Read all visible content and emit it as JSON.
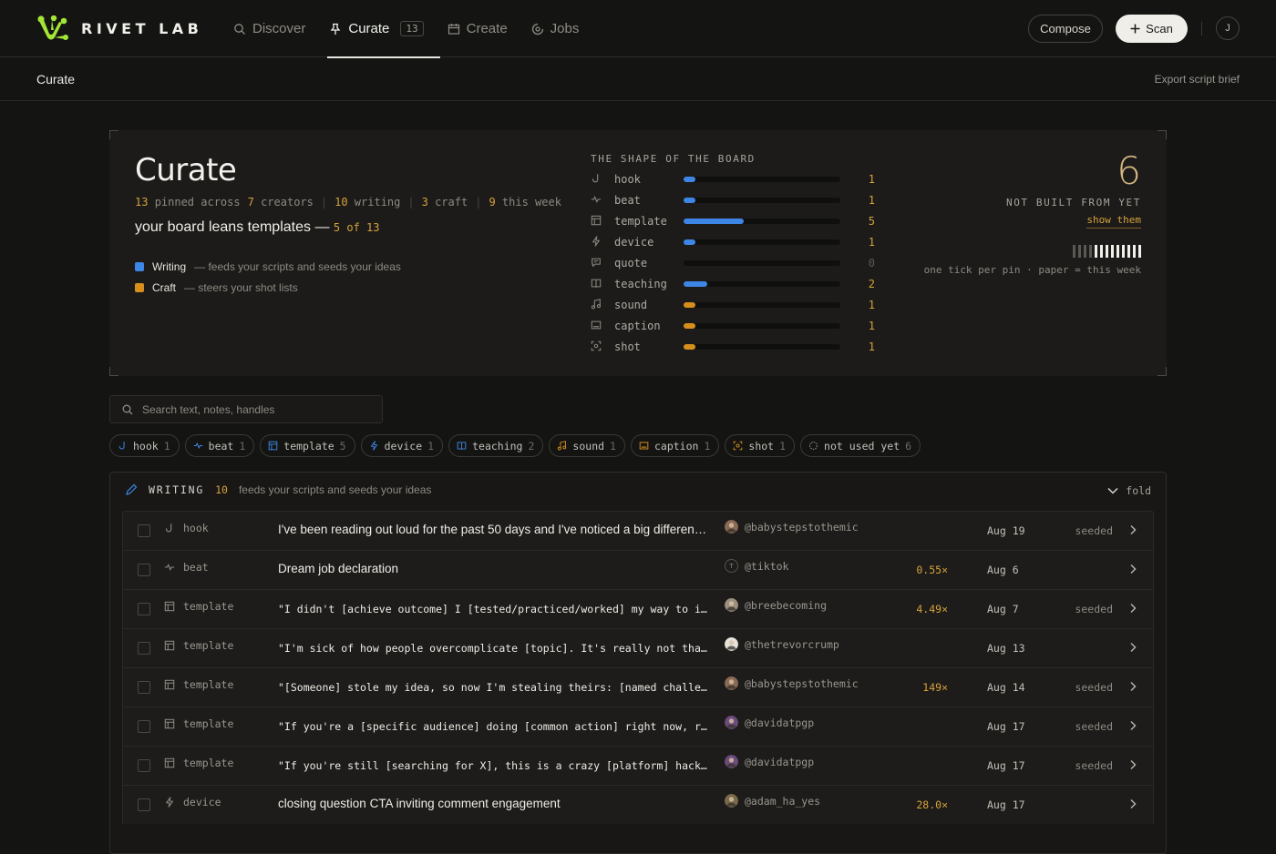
{
  "app": {
    "brand": "RIVET LAB"
  },
  "nav": {
    "items": [
      {
        "label": "Discover",
        "icon": "search-icon"
      },
      {
        "label": "Curate",
        "icon": "pin-icon",
        "badge": "13",
        "active": true
      },
      {
        "label": "Create",
        "icon": "calendar-icon"
      },
      {
        "label": "Jobs",
        "icon": "spinner-icon"
      }
    ],
    "compose": "Compose",
    "scan": "Scan",
    "avatar": "J"
  },
  "subbar": {
    "title": "Curate",
    "export": "Export script brief"
  },
  "hero": {
    "title": "Curate",
    "stats": [
      {
        "num": "13",
        "text": "pinned across"
      },
      {
        "num": "7",
        "text": "creators"
      },
      {
        "num": "10",
        "text": "writing"
      },
      {
        "num": "3",
        "text": "craft"
      },
      {
        "num": "9",
        "text": "this week"
      }
    ],
    "lean_text": "your board leans templates —",
    "lean_highlight": "5 of 13",
    "legend": [
      {
        "name": "Writing",
        "desc": "— feeds your scripts and seeds your ideas",
        "color": "#3e86e6"
      },
      {
        "name": "Craft",
        "desc": "— steers your shot lists",
        "color": "#d68f1d"
      }
    ],
    "shape_title": "THE SHAPE OF THE BOARD",
    "shape": [
      {
        "label": "hook",
        "count": 1,
        "group": "writing",
        "icon": "hook-icon"
      },
      {
        "label": "beat",
        "count": 1,
        "group": "writing",
        "icon": "pulse-icon"
      },
      {
        "label": "template",
        "count": 5,
        "group": "writing",
        "icon": "template-icon"
      },
      {
        "label": "device",
        "count": 1,
        "group": "writing",
        "icon": "bolt-icon"
      },
      {
        "label": "quote",
        "count": 0,
        "group": "writing",
        "icon": "quote-icon"
      },
      {
        "label": "teaching",
        "count": 2,
        "group": "writing",
        "icon": "book-icon"
      },
      {
        "label": "sound",
        "count": 1,
        "group": "craft",
        "icon": "music-icon"
      },
      {
        "label": "caption",
        "count": 1,
        "group": "craft",
        "icon": "caption-icon"
      },
      {
        "label": "shot",
        "count": 1,
        "group": "craft",
        "icon": "focus-icon"
      }
    ],
    "shape_max": 13,
    "unbuilt_count": "6",
    "unbuilt_label": "NOT BUILT FROM YET",
    "show_them": "show them",
    "tick_week": [
      false,
      false,
      false,
      false,
      true,
      true,
      true,
      true,
      true,
      true,
      true,
      true,
      true
    ],
    "tick_note": "one tick per pin · paper = this week"
  },
  "search": {
    "placeholder": "Search text, notes, handles"
  },
  "chips": [
    {
      "label": "hook",
      "count": "1",
      "icon": "hook-icon",
      "color": "#3e86e6"
    },
    {
      "label": "beat",
      "count": "1",
      "icon": "pulse-icon",
      "color": "#3e86e6"
    },
    {
      "label": "template",
      "count": "5",
      "icon": "template-icon",
      "color": "#3e86e6"
    },
    {
      "label": "device",
      "count": "1",
      "icon": "bolt-icon",
      "color": "#3e86e6"
    },
    {
      "label": "teaching",
      "count": "2",
      "icon": "book-icon",
      "color": "#3e86e6"
    },
    {
      "label": "sound",
      "count": "1",
      "icon": "music-icon",
      "color": "#d68f1d"
    },
    {
      "label": "caption",
      "count": "1",
      "icon": "caption-icon",
      "color": "#d68f1d"
    },
    {
      "label": "shot",
      "count": "1",
      "icon": "focus-icon",
      "color": "#d68f1d"
    },
    {
      "label": "not used yet",
      "count": "6",
      "icon": "circle-icon",
      "color": "#9a978f"
    }
  ],
  "writing": {
    "title": "WRITING",
    "count": "10",
    "desc": "feeds your scripts and seeds your ideas",
    "fold": "fold",
    "rows": [
      {
        "type": "hook",
        "icon": "hook-icon",
        "text": "I've been reading out loud for the past 50 days and I've noticed a big difference in how I speak",
        "mono": false,
        "avatar": "photo",
        "avatar_color": "#8a6a55",
        "handle": "@babystepstothemic",
        "mult": "",
        "date": "Aug 19",
        "status": "seeded"
      },
      {
        "type": "beat",
        "icon": "pulse-icon",
        "text": "Dream job declaration",
        "mono": false,
        "avatar": "initial",
        "initial": "T",
        "handle": "@tiktok",
        "mult": "0.55×",
        "date": "Aug 6",
        "status": ""
      },
      {
        "type": "template",
        "icon": "template-icon",
        "text": "\"I didn't [achieve outcome] I [tested/practiced/worked] my way to it.\"",
        "mono": true,
        "avatar": "photo",
        "avatar_color": "#9b8f80",
        "handle": "@breebecoming",
        "mult": "4.49×",
        "date": "Aug 7",
        "status": "seeded"
      },
      {
        "type": "template",
        "icon": "template-icon",
        "text": "\"I'm sick of how people overcomplicate [topic]. It's really not that hard.\"",
        "mono": true,
        "avatar": "photo",
        "avatar_color": "#e6e3dc",
        "handle": "@thetrevorcrump",
        "mult": "",
        "date": "Aug 13",
        "status": ""
      },
      {
        "type": "template",
        "icon": "template-icon",
        "text": "\"[Someone] stole my idea, so now I'm stealing theirs: [named challenge]\"",
        "mono": true,
        "avatar": "photo",
        "avatar_color": "#8a6a55",
        "handle": "@babystepstothemic",
        "mult": "149×",
        "date": "Aug 14",
        "status": "seeded"
      },
      {
        "type": "template",
        "icon": "template-icon",
        "text": "\"If you're a [specific audience] doing [common action] right now, read this.\"",
        "mono": true,
        "avatar": "photo",
        "avatar_color": "#6c4a7a",
        "handle": "@davidatpgp",
        "mult": "",
        "date": "Aug 17",
        "status": "seeded"
      },
      {
        "type": "template",
        "icon": "template-icon",
        "text": "\"If you're still [searching for X], this is a crazy [platform] hack for you.\"",
        "mono": true,
        "avatar": "photo",
        "avatar_color": "#6c4a7a",
        "handle": "@davidatpgp",
        "mult": "",
        "date": "Aug 17",
        "status": "seeded"
      },
      {
        "type": "device",
        "icon": "bolt-icon",
        "text": "closing question CTA inviting comment engagement",
        "mono": false,
        "avatar": "photo",
        "avatar_color": "#7a6a4a",
        "handle": "@adam_ha_yes",
        "mult": "28.0×",
        "date": "Aug 17",
        "status": ""
      }
    ]
  }
}
